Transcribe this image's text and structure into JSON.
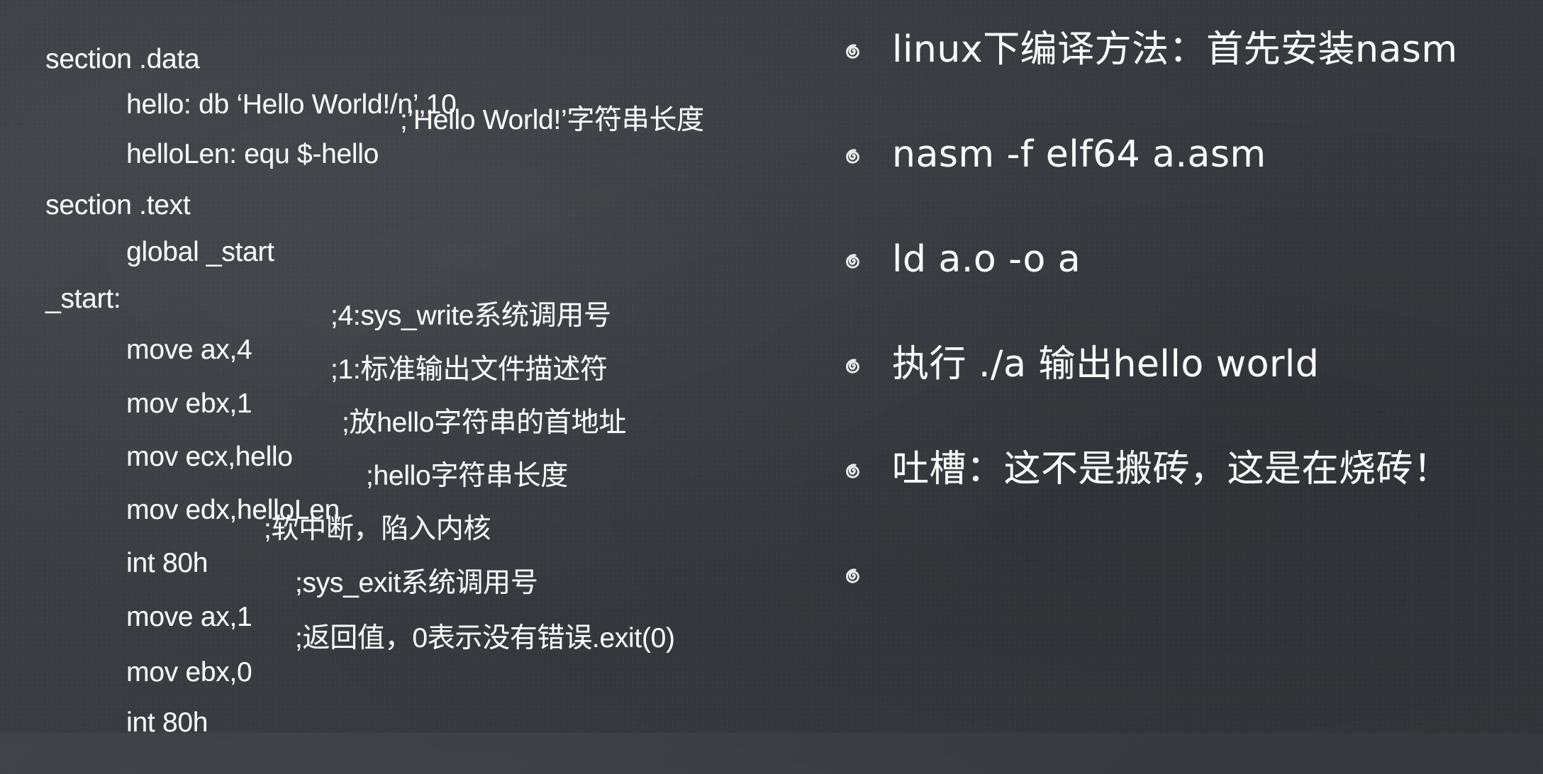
{
  "code": {
    "lines": [
      {
        "text": "section .data",
        "comment": ""
      },
      {
        "text": "hello: db ‘Hello World!/n’,10",
        "comment": ""
      },
      {
        "text": "helloLen: equ $-hello",
        "comment": ";’Hello World!’字符串长度"
      },
      {
        "text": "section .text",
        "comment": ""
      },
      {
        "text": "global _start",
        "comment": ""
      },
      {
        "text": "_start:",
        "comment": ""
      },
      {
        "text": "move ax,4",
        "comment": ";4:sys_write系统调用号"
      },
      {
        "text": "mov ebx,1",
        "comment": ";1:标准输出文件描述符"
      },
      {
        "text": "mov ecx,hello",
        "comment": ";放hello字符串的首地址"
      },
      {
        "text": "mov edx,helloLen",
        "comment": ";hello字符串长度"
      },
      {
        "text": "int 80h",
        "comment": ";软中断，陷入内核"
      },
      {
        "text": "move ax,1",
        "comment": ";sys_exit系统调用号"
      },
      {
        "text": "mov ebx,0",
        "comment": ";返回值，0表示没有错误.exit(0)"
      },
      {
        "text": "int 80h",
        "comment": ""
      }
    ]
  },
  "bullets": {
    "icon": "spiral-bullet-icon",
    "items": [
      {
        "text": "linux下编译方法：首先安装nasm"
      },
      {
        "text": "nasm -f elf64 a.asm"
      },
      {
        "text": "ld a.o -o a"
      },
      {
        "text": "执行 ./a 输出hello world"
      },
      {
        "text": "吐槽：这不是搬砖，这是在烧砖！"
      },
      {
        "text": ""
      }
    ]
  }
}
